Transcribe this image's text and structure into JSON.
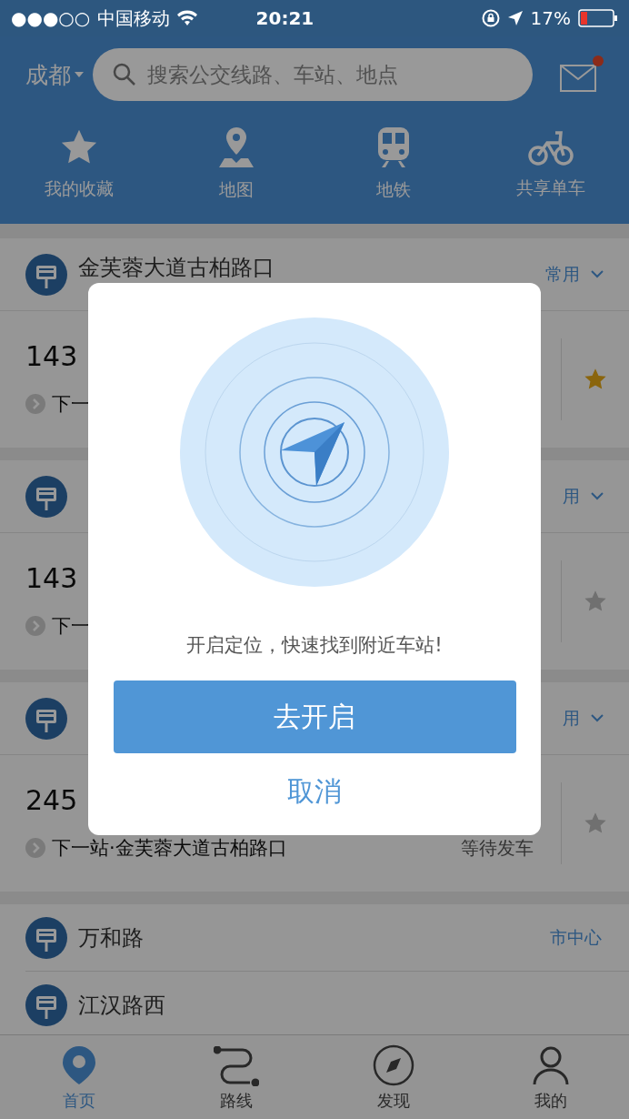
{
  "status_bar": {
    "signal": "●●●○○",
    "carrier": "中国移动",
    "time": "20:21",
    "battery": "17%"
  },
  "header": {
    "city": "成都",
    "search": {
      "placeholder": "搜索公交线路、车站、地点"
    },
    "mail_unread": true
  },
  "quick_nav": [
    {
      "label": "我的收藏",
      "kind": "star"
    },
    {
      "label": "地图",
      "kind": "map"
    },
    {
      "label": "地铁",
      "kind": "metro"
    },
    {
      "label": "共享单车",
      "kind": "bike"
    }
  ],
  "stops": [
    {
      "name": "金芙蓉大道古柏路口",
      "tag": "常用",
      "route": "143",
      "next": "下一",
      "starred": true
    },
    {
      "tag": "用",
      "route": "143",
      "next": "下一",
      "starred": false
    },
    {
      "tag": "用",
      "route": "245",
      "next": "下一站·金芙蓉大道古柏路口",
      "status": "等待发车",
      "starred": false
    }
  ],
  "places": [
    {
      "name": "万和路",
      "tag": "市中心"
    },
    {
      "name": "江汉路西"
    }
  ],
  "tab_bar": [
    {
      "label": "首页",
      "kind": "home",
      "selected": true
    },
    {
      "label": "路线",
      "kind": "route",
      "selected": false
    },
    {
      "label": "发现",
      "kind": "discover",
      "selected": false
    },
    {
      "label": "我的",
      "kind": "me",
      "selected": false
    }
  ],
  "dialog": {
    "message": "开启定位，快速找到附近车站!",
    "confirm": "去开启",
    "cancel": "取消"
  }
}
